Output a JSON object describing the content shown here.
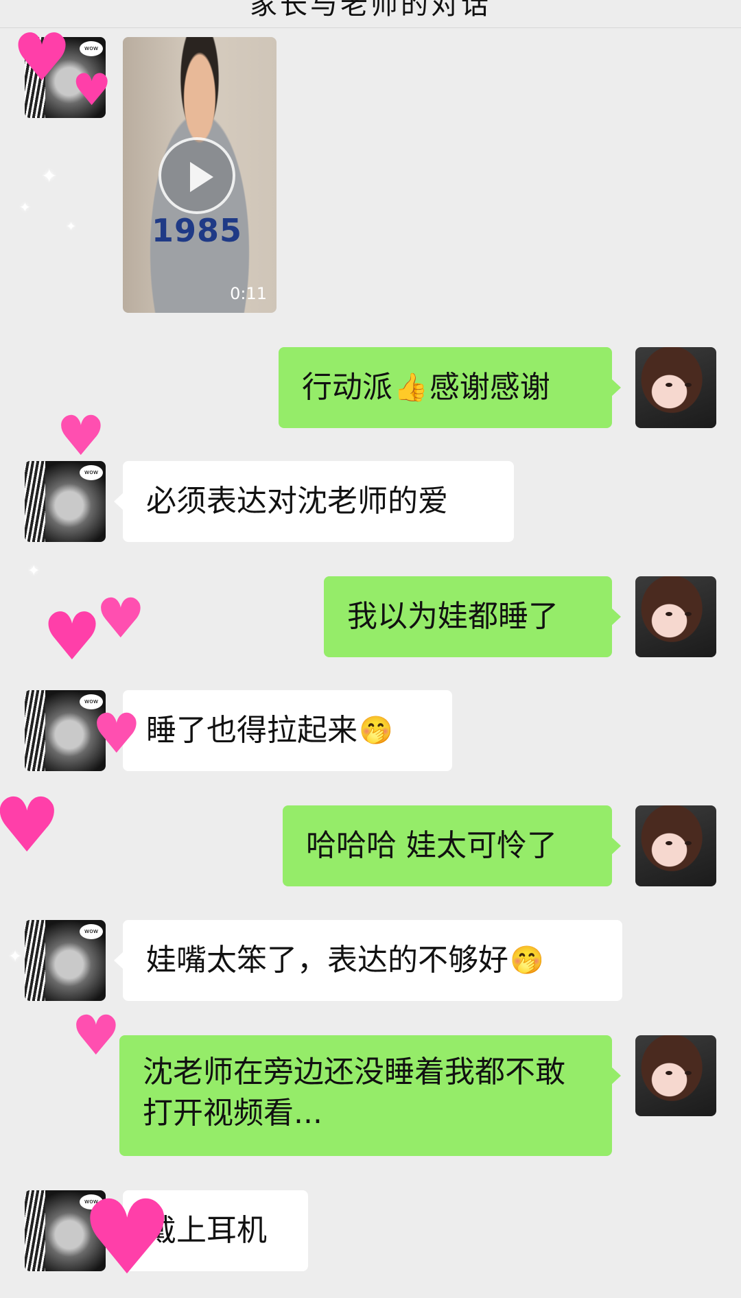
{
  "header": {
    "title": "家长与老师的对话"
  },
  "video": {
    "duration": "0:11",
    "shirt_text": "1985"
  },
  "messages": [
    {
      "side": "right",
      "text": "行动派",
      "emoji": "👍",
      "text2": "感谢感谢"
    },
    {
      "side": "left",
      "text": "必须表达对沈老师的爱"
    },
    {
      "side": "right",
      "text": "我以为娃都睡了"
    },
    {
      "side": "left",
      "text": "睡了也得拉起来",
      "emoji": "🤭"
    },
    {
      "side": "right",
      "text": "哈哈哈 娃太可怜了"
    },
    {
      "side": "left",
      "text": "娃嘴太笨了，表达的不够好",
      "emoji": "🤭"
    },
    {
      "side": "right",
      "text": "沈老师在旁边还没睡着我都不敢打开视频看..."
    },
    {
      "side": "left",
      "text": "戴上耳机"
    }
  ],
  "avatar_cat_caption": "wow",
  "colors": {
    "chat_bg": "#ededed",
    "bubble_self": "#95ec69",
    "bubble_other": "#ffffff",
    "sticker_pink": "#ff3fa9"
  }
}
